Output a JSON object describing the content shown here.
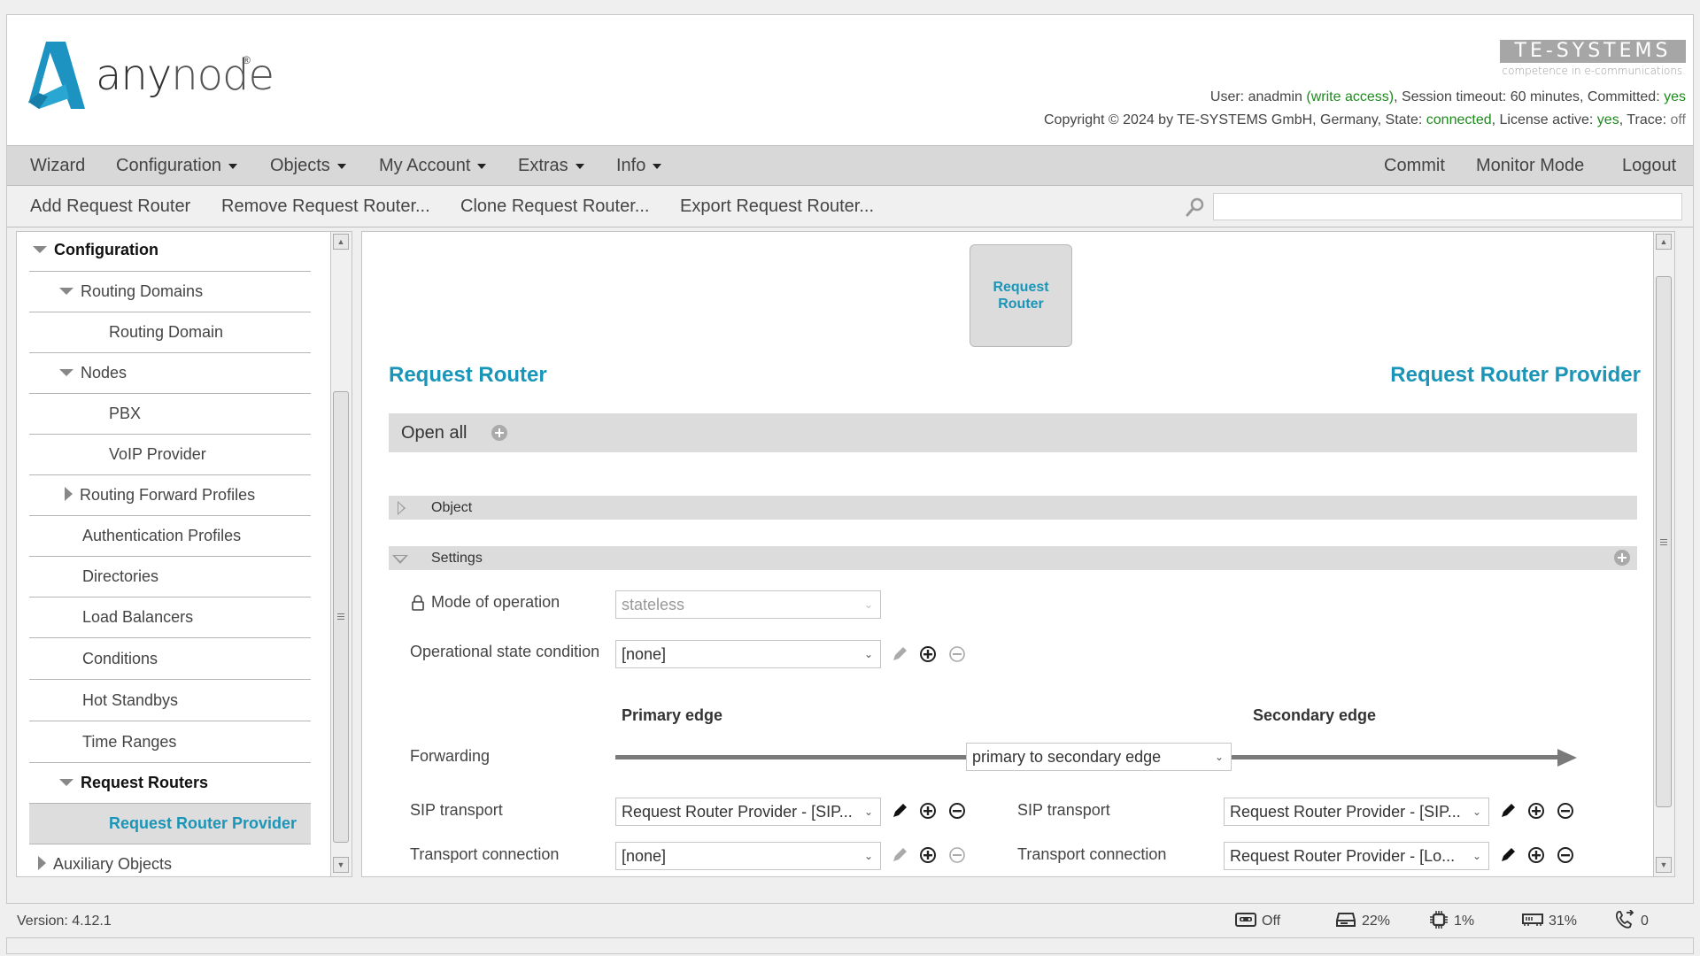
{
  "header": {
    "logo_text_bold": "any",
    "logo_text_light": "node",
    "logo_registered": "®",
    "vendor_logo": "TE-SYSTEMS",
    "vendor_tagline": "competence in e-communications.",
    "user_label": "User: ",
    "user_name": "anadmin",
    "user_access": "(write access)",
    "session_label": ", Session timeout: 60 minutes, Committed: ",
    "committed": "yes",
    "copyright": "Copyright © 2024 by TE-SYSTEMS GmbH, Germany, State: ",
    "state": "connected",
    "license_label": ", License active: ",
    "license": "yes",
    "trace_label": ", Trace: ",
    "trace": "off"
  },
  "menu": {
    "left": [
      {
        "label": "Wizard",
        "dropdown": false
      },
      {
        "label": "Configuration",
        "dropdown": true
      },
      {
        "label": "Objects",
        "dropdown": true
      },
      {
        "label": "My Account",
        "dropdown": true
      },
      {
        "label": "Extras",
        "dropdown": true
      },
      {
        "label": "Info",
        "dropdown": true
      }
    ],
    "right": [
      {
        "label": "Commit"
      },
      {
        "label": "Monitor Mode"
      },
      {
        "label": "Logout"
      }
    ]
  },
  "toolbar": {
    "actions": [
      {
        "label": "Add Request Router"
      },
      {
        "label": "Remove Request Router..."
      },
      {
        "label": "Clone Request Router..."
      },
      {
        "label": "Export Request Router..."
      }
    ],
    "search_value": ""
  },
  "sidebar": {
    "items": [
      {
        "label": "Configuration",
        "state": "expanded"
      },
      {
        "label": "Routing Domains",
        "state": "expanded"
      },
      {
        "label": "Routing Domain",
        "state": "leaf"
      },
      {
        "label": "Nodes",
        "state": "expanded"
      },
      {
        "label": "PBX",
        "state": "leaf"
      },
      {
        "label": "VoIP Provider",
        "state": "leaf"
      },
      {
        "label": "Routing Forward Profiles",
        "state": "collapsed"
      },
      {
        "label": "Authentication Profiles",
        "state": "leaf"
      },
      {
        "label": "Directories",
        "state": "leaf"
      },
      {
        "label": "Load Balancers",
        "state": "leaf"
      },
      {
        "label": "Conditions",
        "state": "leaf"
      },
      {
        "label": "Hot Standbys",
        "state": "leaf"
      },
      {
        "label": "Time Ranges",
        "state": "leaf"
      },
      {
        "label": "Request Routers",
        "state": "expanded"
      },
      {
        "label": "Request Router Provider",
        "state": "selected"
      },
      {
        "label": "Auxiliary Objects",
        "state": "collapsed"
      }
    ]
  },
  "main": {
    "node_box": {
      "line1": "Request",
      "line2": "Router"
    },
    "title_left": "Request Router",
    "title_right": "Request Router Provider",
    "open_all": "Open all",
    "sections": {
      "object": "Object",
      "settings": "Settings"
    },
    "form": {
      "mode_label": "Mode of operation",
      "mode_value": "stateless",
      "opstate_label": "Operational state condition",
      "opstate_value": "[none]",
      "primary_edge": "Primary edge",
      "secondary_edge": "Secondary edge",
      "forwarding_label": "Forwarding",
      "forwarding_value": "primary to secondary edge",
      "primary": {
        "sip_label": "SIP transport",
        "sip_value": "Request Router Provider - [SIP...",
        "conn_label": "Transport connection",
        "conn_value": "[none]"
      },
      "secondary": {
        "sip_label": "SIP transport",
        "sip_value": "Request Router Provider - [SIP...",
        "conn_label": "Transport connection",
        "conn_value": "Request Router Provider - [Lo..."
      }
    }
  },
  "statusbar": {
    "version": "Version: 4.12.1",
    "recording": "Off",
    "disk": "22%",
    "cpu": "1%",
    "memory": "31%",
    "calls": "0"
  },
  "colors": {
    "accent": "#1a95b8",
    "ok_green": "#1e8a1e"
  }
}
